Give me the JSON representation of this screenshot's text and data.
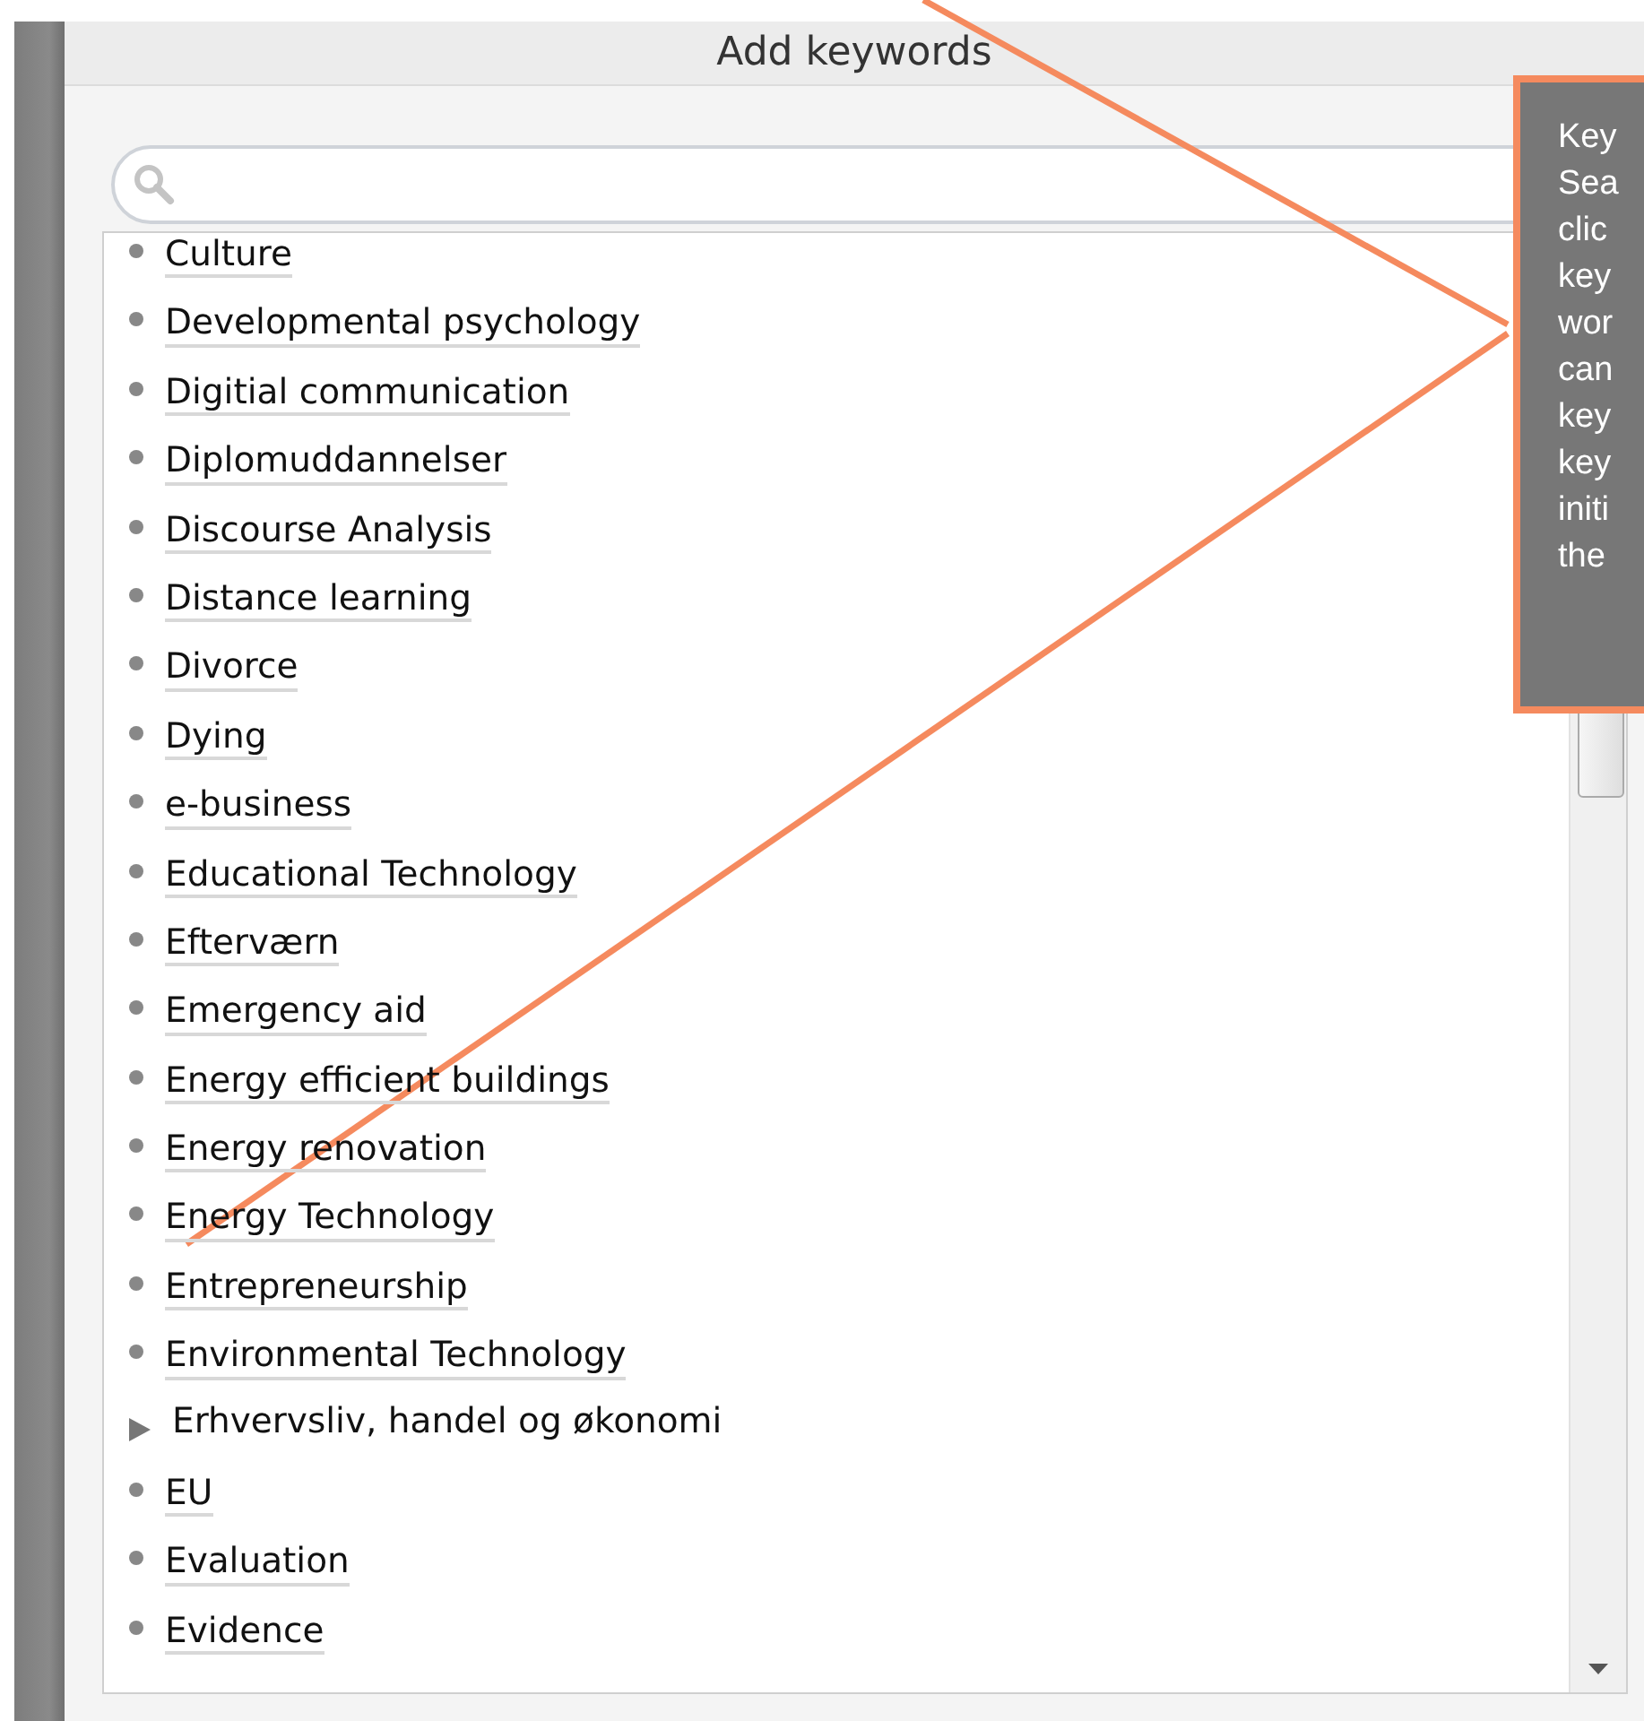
{
  "dialog": {
    "title": "Add keywords"
  },
  "keywords": [
    {
      "label": "Culture",
      "kind": "leaf"
    },
    {
      "label": "Developmental psychology",
      "kind": "leaf"
    },
    {
      "label": "Digitial communication",
      "kind": "leaf"
    },
    {
      "label": "Diplomuddannelser",
      "kind": "leaf"
    },
    {
      "label": "Discourse Analysis",
      "kind": "leaf"
    },
    {
      "label": "Distance learning",
      "kind": "leaf"
    },
    {
      "label": "Divorce",
      "kind": "leaf"
    },
    {
      "label": "Dying",
      "kind": "leaf"
    },
    {
      "label": "e-business",
      "kind": "leaf"
    },
    {
      "label": "Educational Technology",
      "kind": "leaf"
    },
    {
      "label": "Efterværn",
      "kind": "leaf"
    },
    {
      "label": "Emergency aid",
      "kind": "leaf"
    },
    {
      "label": "Energy efficient buildings",
      "kind": "leaf"
    },
    {
      "label": "Energy renovation",
      "kind": "leaf"
    },
    {
      "label": "Energy Technology",
      "kind": "leaf"
    },
    {
      "label": "Entrepreneurship",
      "kind": "leaf"
    },
    {
      "label": "Environmental Technology",
      "kind": "leaf"
    },
    {
      "label": "Erhvervsliv, handel og økonomi",
      "kind": "branch"
    },
    {
      "label": "EU",
      "kind": "leaf"
    },
    {
      "label": "Evaluation",
      "kind": "leaf"
    },
    {
      "label": "Evidence",
      "kind": "leaf"
    }
  ],
  "callout": {
    "lines": [
      "Key",
      "Sea",
      "clic",
      "key",
      "wor",
      "can",
      "key",
      "key",
      "initi",
      "the"
    ]
  }
}
